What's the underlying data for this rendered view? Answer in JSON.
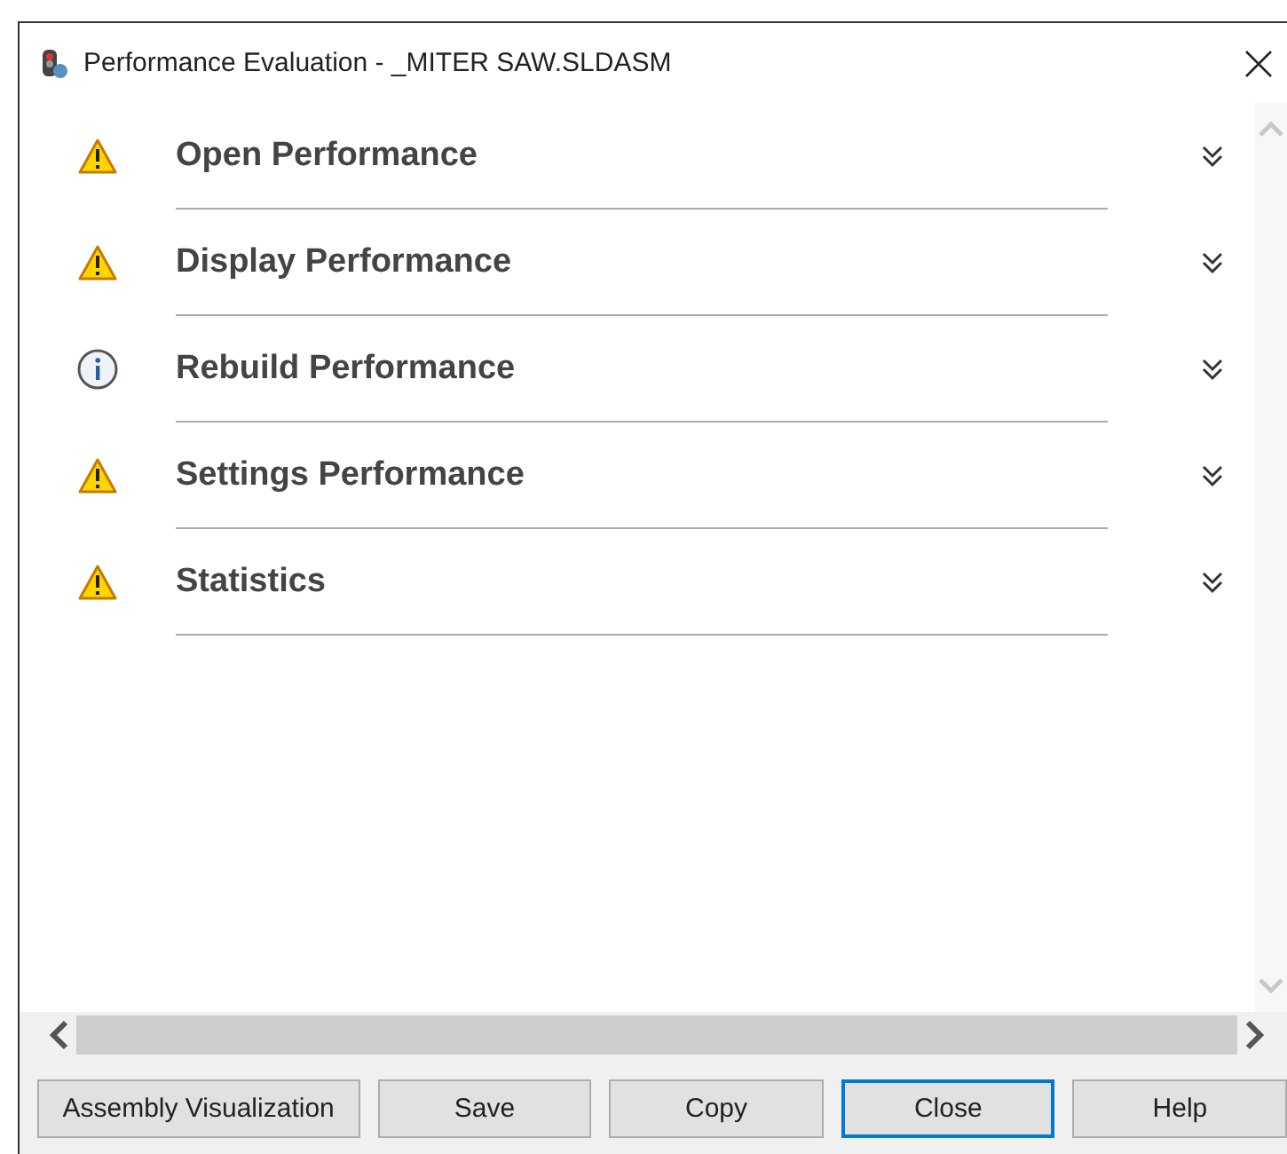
{
  "window": {
    "title": "Performance Evaluation - _MITER SAW.SLDASM"
  },
  "sections": [
    {
      "label": "Open Performance",
      "kind": "warning",
      "expanded": false
    },
    {
      "label": "Display Performance",
      "kind": "warning",
      "expanded": false
    },
    {
      "label": "Rebuild Performance",
      "kind": "info",
      "expanded": false
    },
    {
      "label": "Settings Performance",
      "kind": "warning",
      "expanded": false
    },
    {
      "label": "Statistics",
      "kind": "warning",
      "expanded": false
    }
  ],
  "buttons": [
    {
      "label": "Assembly Visualization",
      "focused": false
    },
    {
      "label": "Save",
      "focused": false
    },
    {
      "label": "Copy",
      "focused": false
    },
    {
      "label": "Close",
      "focused": true
    },
    {
      "label": "Help",
      "focused": false
    }
  ]
}
